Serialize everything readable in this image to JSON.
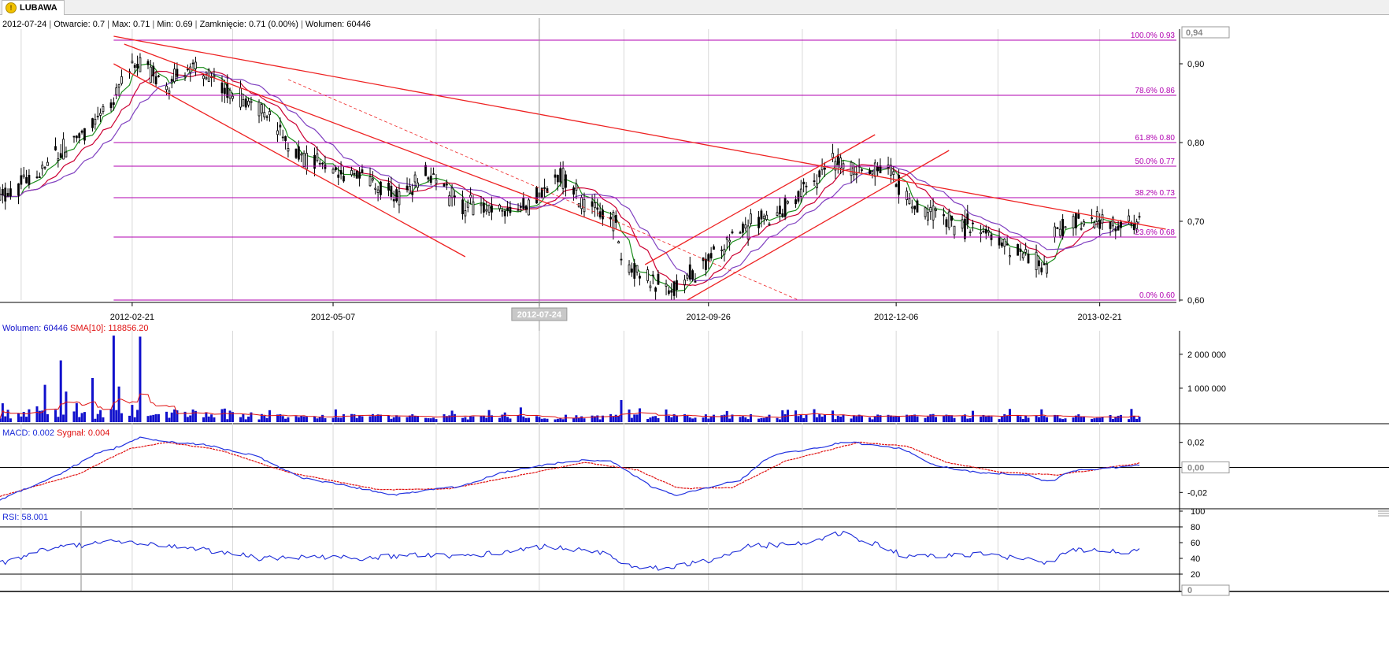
{
  "tab": {
    "label": "LUBAWA",
    "icon": "warning-icon"
  },
  "info_bar": {
    "date": "2012-07-24",
    "open": "Otwarcie: 0.7",
    "max": "Max: 0.71",
    "min": "Min: 0.69",
    "close": "Zamknięcie: 0.71 (0.00%)",
    "volume": "Wolumen: 60446"
  },
  "colors": {
    "candle": "#000000",
    "ma_fast": "#1a8c1a",
    "ma_mid": "#cc0033",
    "ma_slow": "#8040c0",
    "fib": "#b000b0",
    "trendline": "#ee2222",
    "volume": "#1010cc",
    "macd": "#2030e0",
    "signal": "#e01010",
    "rsi": "#1a2ad8",
    "grid": "#d8d8d8"
  },
  "chart_data": [
    {
      "type": "candlestick",
      "x_tick_labels": [
        "2012-02-21",
        "2012-05-07",
        "2012-07-24",
        "2012-09-26",
        "2012-12-06",
        "2013-02-21"
      ],
      "x_tick_dates": [
        "2012-02-21",
        "2012-05-07",
        "2012-07-24",
        "2012-09-26",
        "2012-12-06",
        "2013-02-21"
      ],
      "x_range": [
        "2012-01-02",
        "2013-03-22"
      ],
      "y_range": [
        0.6,
        0.94
      ],
      "y_tick_labels": [
        "0,90",
        "0,80",
        "0,70",
        "0,60"
      ],
      "y_ticks": [
        0.9,
        0.8,
        0.7,
        0.6
      ],
      "last_price_label": "0,94",
      "crosshair": {
        "date": "2012-07-24",
        "label": "2012-07-24"
      },
      "data_last_date": "2013-01-31",
      "moving_averages": [
        "short (green)",
        "medium (red)",
        "long (purple)"
      ],
      "fibonacci_levels": [
        {
          "value": 0.93,
          "label": "100.0% 0.93"
        },
        {
          "value": 0.86,
          "label": "78.6% 0.86"
        },
        {
          "value": 0.8,
          "label": "61.8% 0.80"
        },
        {
          "value": 0.77,
          "label": "50.0% 0.77"
        },
        {
          "value": 0.73,
          "label": "38.2% 0.73"
        },
        {
          "value": 0.68,
          "label": "23.6% 0.68"
        },
        {
          "value": 0.6,
          "label": "0.0% 0.60"
        }
      ],
      "fibonacci_start": "2012-02-14",
      "price_waypoints": [
        [
          "2012-01-02",
          0.73
        ],
        [
          "2012-01-20",
          0.77
        ],
        [
          "2012-02-05",
          0.82
        ],
        [
          "2012-02-14",
          0.86
        ],
        [
          "2012-02-18",
          0.89
        ],
        [
          "2012-02-24",
          0.9
        ],
        [
          "2012-03-05",
          0.87
        ],
        [
          "2012-03-16",
          0.9
        ],
        [
          "2012-03-28",
          0.86
        ],
        [
          "2012-04-10",
          0.84
        ],
        [
          "2012-04-25",
          0.78
        ],
        [
          "2012-05-15",
          0.76
        ],
        [
          "2012-06-01",
          0.73
        ],
        [
          "2012-06-12",
          0.76
        ],
        [
          "2012-06-25",
          0.72
        ],
        [
          "2012-07-10",
          0.71
        ],
        [
          "2012-07-20",
          0.72
        ],
        [
          "2012-08-01",
          0.76
        ],
        [
          "2012-08-10",
          0.72
        ],
        [
          "2012-08-22",
          0.7
        ],
        [
          "2012-08-24",
          0.65
        ],
        [
          "2012-09-05",
          0.62
        ],
        [
          "2012-09-12",
          0.61
        ],
        [
          "2012-09-25",
          0.65
        ],
        [
          "2012-10-08",
          0.69
        ],
        [
          "2012-10-22",
          0.71
        ],
        [
          "2012-11-02",
          0.74
        ],
        [
          "2012-11-12",
          0.78
        ],
        [
          "2012-11-22",
          0.76
        ],
        [
          "2012-12-03",
          0.77
        ],
        [
          "2012-12-12",
          0.72
        ],
        [
          "2012-12-26",
          0.7
        ],
        [
          "2013-01-05",
          0.69
        ],
        [
          "2013-01-15",
          0.67
        ],
        [
          "2013-01-24",
          0.66
        ],
        [
          "2013-01-31",
          0.64
        ],
        [
          "2013-02-05",
          0.69
        ],
        [
          "2013-02-15",
          0.7
        ],
        [
          "2013-03-10",
          0.69
        ]
      ],
      "trendlines": [
        {
          "from": [
            "2012-02-14",
            0.935
          ],
          "to": [
            "2013-03-18",
            0.69
          ],
          "style": "solid"
        },
        {
          "from": [
            "2012-02-18",
            0.925
          ],
          "to": [
            "2012-08-30",
            0.68
          ],
          "style": "solid"
        },
        {
          "from": [
            "2012-02-14",
            0.9
          ],
          "to": [
            "2012-06-26",
            0.655
          ],
          "style": "solid"
        },
        {
          "from": [
            "2012-04-20",
            0.88
          ],
          "to": [
            "2012-10-30",
            0.6
          ],
          "style": "dashed"
        },
        {
          "from": [
            "2012-09-02",
            0.645
          ],
          "to": [
            "2012-11-28",
            0.81
          ],
          "style": "solid"
        },
        {
          "from": [
            "2012-09-18",
            0.6
          ],
          "to": [
            "2012-12-26",
            0.79
          ],
          "style": "solid"
        }
      ]
    },
    {
      "type": "bar",
      "title": "Wolumen: 60446",
      "sma_label": "SMA[10]: 118856.20",
      "y_range": [
        0,
        2600000
      ],
      "y_tick_labels": [
        "2 000 000",
        "1 000 000"
      ],
      "y_ticks": [
        2000000,
        1000000
      ],
      "spikes": [
        [
          "2012-01-25",
          1820000
        ],
        [
          "2012-02-14",
          2550000
        ],
        [
          "2012-02-24",
          2520000
        ],
        [
          "2012-01-27",
          900000
        ],
        [
          "2012-02-06",
          1300000
        ],
        [
          "2012-01-19",
          1100000
        ],
        [
          "2012-03-03",
          1000000
        ],
        [
          "2012-02-16",
          1050000
        ],
        [
          "2012-08-24",
          650000
        ]
      ]
    },
    {
      "type": "line",
      "title": "MACD: 0.002",
      "signal_label": "Sygnał: 0.004",
      "y_range": [
        -0.033,
        0.033
      ],
      "y_tick_labels": [
        "0,02",
        "0,00",
        "-0,02"
      ],
      "y_ticks": [
        0.02,
        0,
        -0.02
      ],
      "zero_label": "0,00",
      "macd_waypoints": [
        [
          "2012-01-02",
          -0.026
        ],
        [
          "2012-01-25",
          -0.005
        ],
        [
          "2012-02-08",
          0.012
        ],
        [
          "2012-02-14",
          0.015
        ],
        [
          "2012-02-24",
          0.024
        ],
        [
          "2012-03-08",
          0.02
        ],
        [
          "2012-03-20",
          0.018
        ],
        [
          "2012-04-08",
          0.009
        ],
        [
          "2012-04-25",
          -0.008
        ],
        [
          "2012-05-20",
          -0.018
        ],
        [
          "2012-05-30",
          -0.022
        ],
        [
          "2012-06-12",
          -0.018
        ],
        [
          "2012-06-25",
          -0.015
        ],
        [
          "2012-07-10",
          -0.004
        ],
        [
          "2012-08-01",
          0.004
        ],
        [
          "2012-08-10",
          0.006
        ],
        [
          "2012-08-20",
          0.005
        ],
        [
          "2012-09-05",
          -0.016
        ],
        [
          "2012-09-14",
          -0.022
        ],
        [
          "2012-10-08",
          -0.01
        ],
        [
          "2012-10-20",
          0.01
        ],
        [
          "2012-11-05",
          0.015
        ],
        [
          "2012-11-18",
          0.021
        ],
        [
          "2012-11-25",
          0.018
        ],
        [
          "2012-12-08",
          0.015
        ],
        [
          "2012-12-20",
          0.002
        ],
        [
          "2013-01-05",
          -0.004
        ],
        [
          "2013-01-25",
          -0.006
        ],
        [
          "2013-02-02",
          -0.012
        ],
        [
          "2013-02-10",
          -0.003
        ],
        [
          "2013-03-10",
          0.002
        ]
      ],
      "signal_waypoints": [
        [
          "2012-01-02",
          -0.023
        ],
        [
          "2012-02-01",
          -0.005
        ],
        [
          "2012-02-20",
          0.015
        ],
        [
          "2012-03-05",
          0.02
        ],
        [
          "2012-03-25",
          0.014
        ],
        [
          "2012-04-20",
          -0.004
        ],
        [
          "2012-05-25",
          -0.018
        ],
        [
          "2012-06-20",
          -0.017
        ],
        [
          "2012-07-15",
          -0.007
        ],
        [
          "2012-08-10",
          0.004
        ],
        [
          "2012-08-30",
          -0.002
        ],
        [
          "2012-09-15",
          -0.017
        ],
        [
          "2012-10-05",
          -0.016
        ],
        [
          "2012-10-25",
          0.005
        ],
        [
          "2012-11-22",
          0.02
        ],
        [
          "2012-12-10",
          0.017
        ],
        [
          "2012-12-25",
          0.004
        ],
        [
          "2013-01-15",
          -0.004
        ],
        [
          "2013-02-05",
          -0.006
        ],
        [
          "2013-03-10",
          0.004
        ]
      ]
    },
    {
      "type": "line",
      "title": "RSI: 58.001",
      "y_range": [
        0,
        100
      ],
      "y_tick_labels": [
        "100",
        "80",
        "60",
        "40",
        "20"
      ],
      "y_ticks": [
        100,
        80,
        60,
        40,
        20
      ],
      "reference_levels": [
        80,
        20
      ],
      "zero_label": "0",
      "rsi_waypoints": [
        [
          "2012-01-02",
          34
        ],
        [
          "2012-01-20",
          52
        ],
        [
          "2012-02-05",
          58
        ],
        [
          "2012-02-14",
          63
        ],
        [
          "2012-02-24",
          59
        ],
        [
          "2012-03-10",
          55
        ],
        [
          "2012-03-25",
          48
        ],
        [
          "2012-04-10",
          40
        ],
        [
          "2012-04-30",
          42
        ],
        [
          "2012-05-20",
          40
        ],
        [
          "2012-06-05",
          45
        ],
        [
          "2012-06-25",
          43
        ],
        [
          "2012-07-10",
          47
        ],
        [
          "2012-07-25",
          55
        ],
        [
          "2012-08-05",
          52
        ],
        [
          "2012-08-20",
          45
        ],
        [
          "2012-08-26",
          30
        ],
        [
          "2012-09-10",
          28
        ],
        [
          "2012-09-25",
          36
        ],
        [
          "2012-10-10",
          55
        ],
        [
          "2012-10-25",
          58
        ],
        [
          "2012-11-05",
          62
        ],
        [
          "2012-11-15",
          72
        ],
        [
          "2012-11-28",
          58
        ],
        [
          "2012-12-10",
          42
        ],
        [
          "2012-12-25",
          44
        ],
        [
          "2013-01-10",
          45
        ],
        [
          "2013-01-25",
          38
        ],
        [
          "2013-02-02",
          34
        ],
        [
          "2013-02-10",
          52
        ],
        [
          "2013-03-01",
          48
        ],
        [
          "2013-03-10",
          52
        ]
      ]
    }
  ]
}
